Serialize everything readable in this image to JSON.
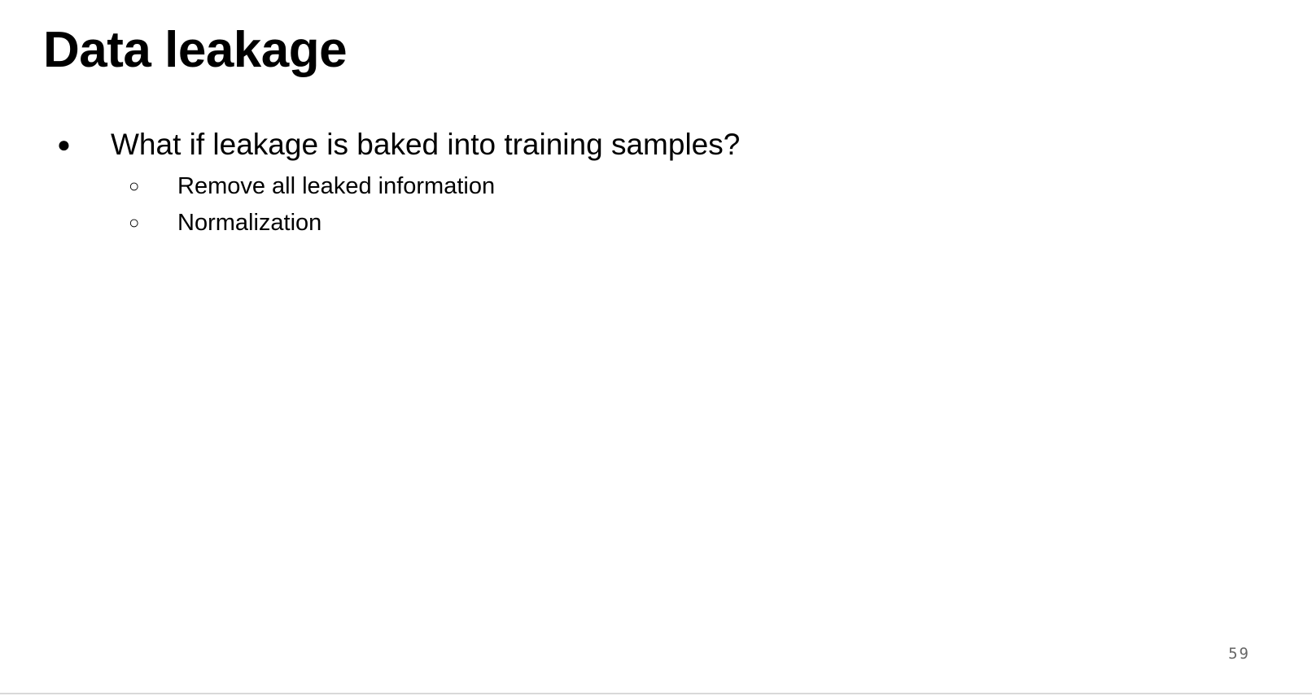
{
  "slide": {
    "title": "Data leakage",
    "bullets": [
      {
        "marker": "●",
        "text": "What if leakage is baked into training samples?",
        "sub_items": [
          {
            "marker": "○",
            "text": "Remove all leaked information"
          },
          {
            "marker": "○",
            "text": "Normalization"
          }
        ]
      }
    ],
    "page_number": "59"
  },
  "colors": {
    "background": "#ffffff",
    "text": "#000000",
    "page_number": "#666666"
  }
}
